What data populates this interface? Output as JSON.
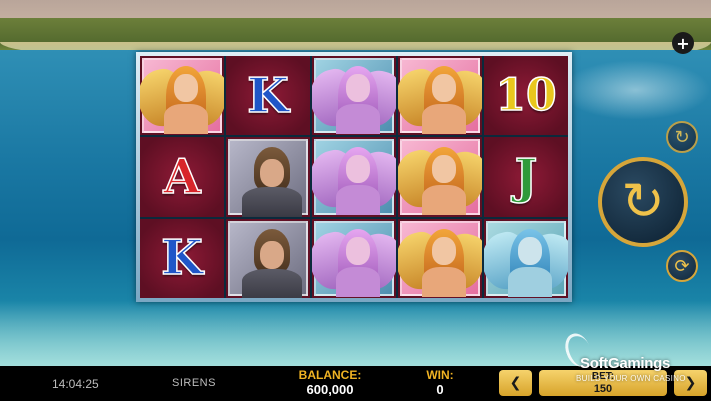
{
  "game": {
    "title": "SIRENS",
    "clock": "14:04:25"
  },
  "reels": [
    [
      {
        "symbol": "gold-siren"
      },
      {
        "symbol": "K"
      },
      {
        "symbol": "purple-siren"
      },
      {
        "symbol": "gold-siren"
      },
      {
        "symbol": "10"
      }
    ],
    [
      {
        "symbol": "A"
      },
      {
        "symbol": "hero"
      },
      {
        "symbol": "purple-siren"
      },
      {
        "symbol": "gold-siren"
      },
      {
        "symbol": "J"
      }
    ],
    [
      {
        "symbol": "K"
      },
      {
        "symbol": "hero"
      },
      {
        "symbol": "purple-siren"
      },
      {
        "symbol": "gold-siren"
      },
      {
        "symbol": "blue-siren"
      }
    ]
  ],
  "controls": {
    "menu_icon": "plus-icon",
    "turbo_icon": "turbo-icon",
    "spin_icon": "spin-arrow-icon",
    "autoplay_icon": "autoplay-icon"
  },
  "status_bar": {
    "balance_label": "BALANCE:",
    "balance_value": "600,000",
    "win_label": "WIN:",
    "win_value": "0",
    "bet_label": "BET:",
    "bet_value": "150",
    "bet_prev_glyph": "❮",
    "bet_next_glyph": "❯"
  },
  "watermark": {
    "title": "SoftGamings",
    "subtitle": "BUILD YOUR OWN CASINO"
  },
  "colors": {
    "accent_gold": "#f0b323",
    "reel_bg": "#8e1a36",
    "bar_bg": "#000000"
  }
}
